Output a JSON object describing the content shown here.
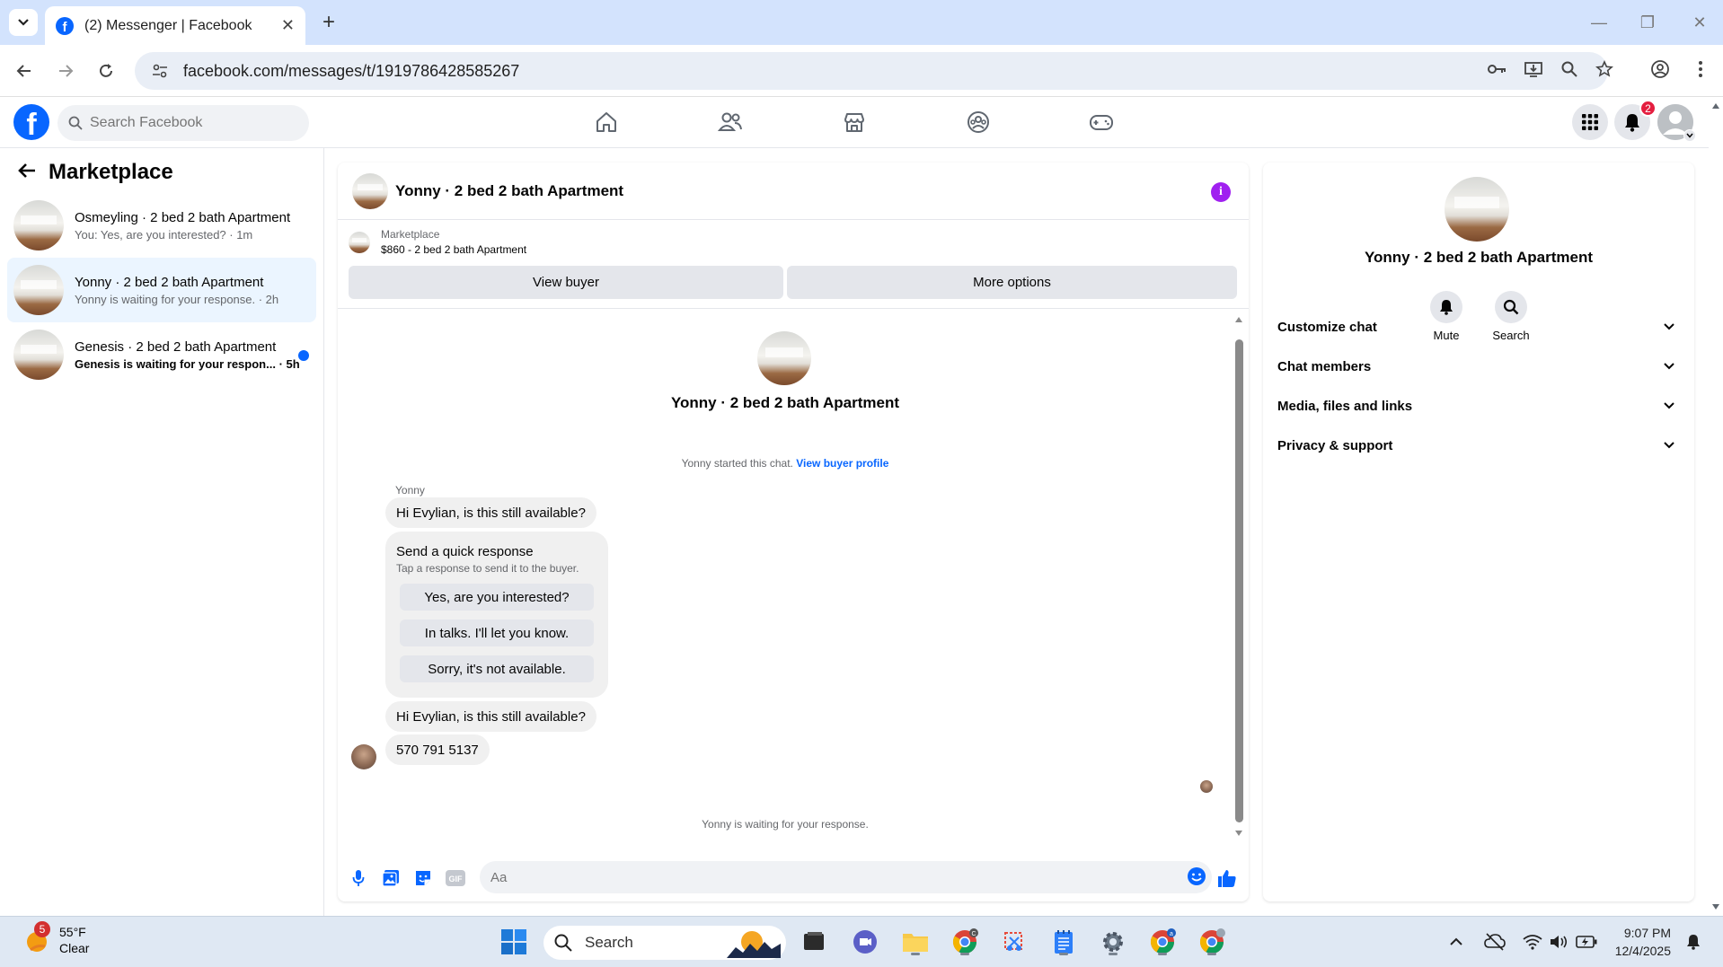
{
  "browser": {
    "tab_title": "(2) Messenger | Facebook",
    "url": "facebook.com/messages/t/1919786428585267"
  },
  "facebook": {
    "search_placeholder": "Search Facebook",
    "notification_count": "2"
  },
  "sidebar": {
    "title": "Marketplace",
    "conversations": [
      {
        "name": "Osmeyling · 2 bed 2 bath Apartment",
        "preview": "You: Yes, are you interested? · 1m",
        "active": false,
        "unread": false
      },
      {
        "name": "Yonny · 2 bed 2 bath Apartment",
        "preview": "Yonny is waiting for your response. · 2h",
        "active": true,
        "unread": false
      },
      {
        "name": "Genesis · 2 bed 2 bath Apartment",
        "preview": "Genesis is waiting for your respon...",
        "time": "· 5h",
        "active": false,
        "unread": true
      }
    ]
  },
  "chat": {
    "title": "Yonny · 2 bed 2 bath Apartment",
    "listing_category": "Marketplace",
    "listing_title": "$860 - 2 bed 2 bath Apartment",
    "view_buyer_label": "View buyer",
    "more_options_label": "More options",
    "intro_name": "Yonny · 2 bed 2 bath Apartment",
    "started_text": "Yonny started this chat.",
    "view_profile_link": "View buyer profile",
    "sender_label": "Yonny",
    "message_1": "Hi Evylian, is this still available?",
    "quick_response_title": "Send a quick response",
    "quick_response_sub": "Tap a response to send it to the buyer.",
    "quick_responses": [
      "Yes, are you interested?",
      "In talks. I'll let you know.",
      "Sorry, it's not available."
    ],
    "message_2": "Hi Evylian, is this still available?",
    "message_3": "570 791 5137",
    "waiting_text": "Yonny is waiting for your response.",
    "input_placeholder": "Aa"
  },
  "right_panel": {
    "name": "Yonny · 2 bed 2 bath Apartment",
    "mute_label": "Mute",
    "search_label": "Search",
    "sections": [
      "Customize chat",
      "Chat members",
      "Media, files and links",
      "Privacy & support"
    ]
  },
  "taskbar": {
    "weather_badge": "5",
    "temperature": "55°F",
    "condition": "Clear",
    "search_label": "Search",
    "time": "9:07 PM",
    "date": "12/4/2025"
  },
  "colors": {
    "fb_blue": "#0866ff",
    "active_convo_bg": "#ebf5ff",
    "bubble_gray": "#f0f0f0",
    "badge_red": "#e41e3f",
    "info_purple": "#a020f0"
  }
}
